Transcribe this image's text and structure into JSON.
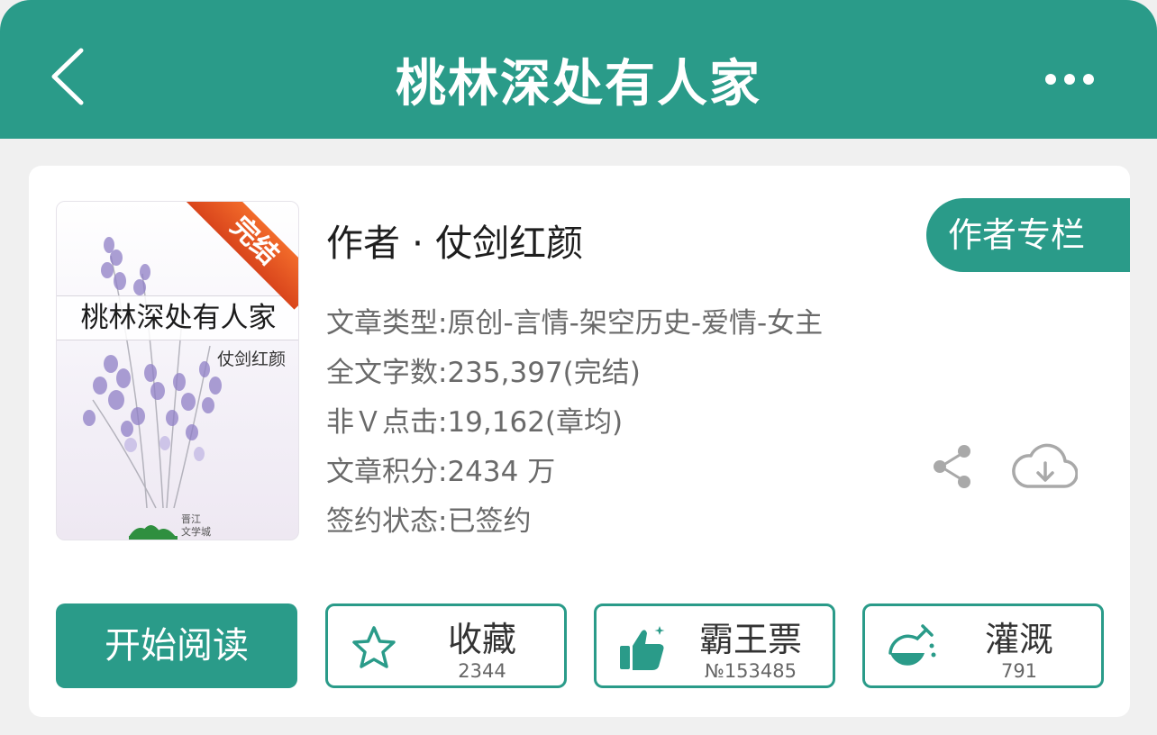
{
  "header": {
    "title": "桃林深处有人家"
  },
  "cover": {
    "title": "桃林深处有人家",
    "author": "仗剑红颜",
    "ribbon": "完结",
    "logo_text": "晋江文学城"
  },
  "book": {
    "author_line": "作者 · 仗剑红颜",
    "author_column_button": "作者专栏",
    "meta": [
      "文章类型:原创-言情-架空历史-爱情-女主",
      "全文字数:235,397(完结)",
      "非Ｖ点击:19,162(章均)",
      "文章积分:2434 万",
      "签约状态:已签约"
    ]
  },
  "actions": {
    "read_label": "开始阅读",
    "favorite": {
      "label": "收藏",
      "count": "2344"
    },
    "vote": {
      "label": "霸王票",
      "count": "№153485"
    },
    "nutrient": {
      "label": "灌溉",
      "count": "791"
    }
  },
  "colors": {
    "accent": "#2a9b89",
    "ribbon": "#e0521f",
    "background": "#f0f0f0"
  }
}
